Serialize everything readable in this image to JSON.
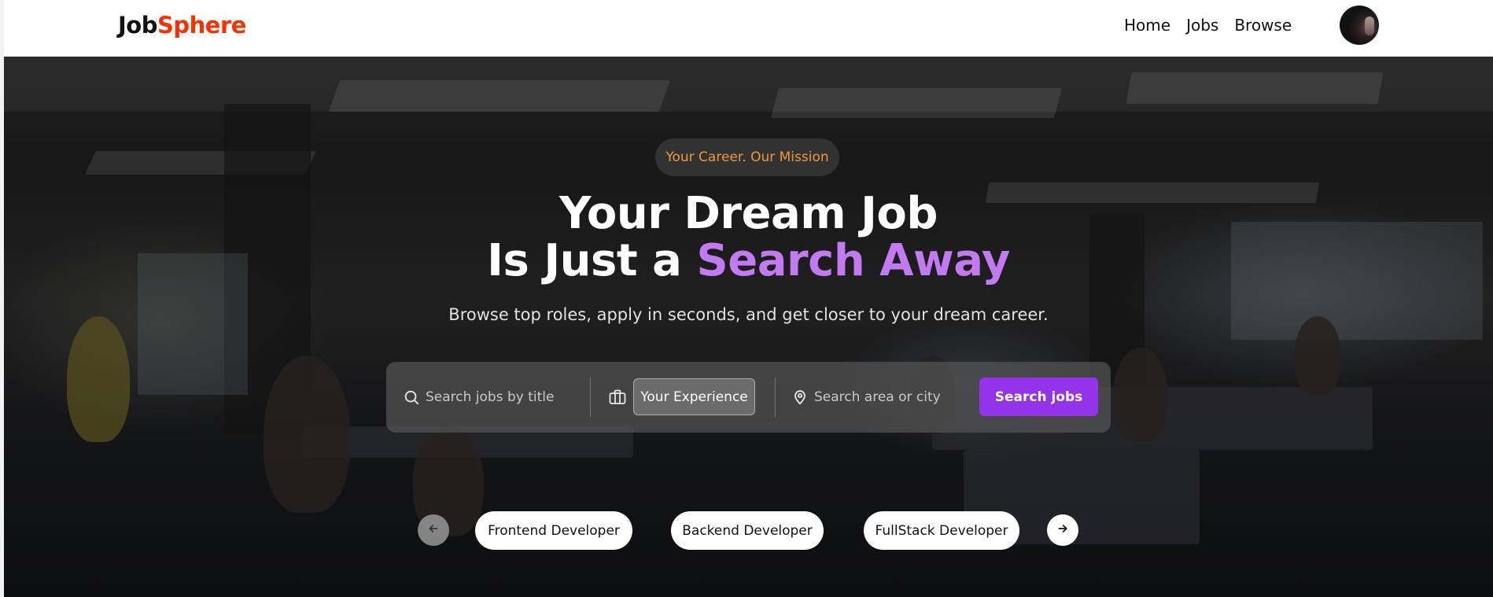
{
  "navbar": {
    "logo": {
      "part1": "Job",
      "part2": "Sphere"
    },
    "links": [
      "Home",
      "Jobs",
      "Browse"
    ],
    "avatar_icon": "user-avatar"
  },
  "hero": {
    "badge": "Your Career. Our Mission",
    "headline": {
      "line1": "Your Dream Job",
      "line2_prefix": "Is Just a ",
      "line2_accent": "Search Away"
    },
    "subtitle": "Browse top roles, apply in seconds, and get closer to your dream career."
  },
  "search": {
    "title_placeholder": "Search jobs by title",
    "experience_label": "Your Experience",
    "location_placeholder": "Search area or city",
    "button_label": "Search jobs",
    "icons": [
      "search-icon",
      "briefcase-icon",
      "map-pin-icon"
    ]
  },
  "categories": {
    "items": [
      "Frontend Developer",
      "Backend Developer",
      "FullStack Developer"
    ],
    "prev_icon": "arrow-left-icon",
    "next_icon": "arrow-right-icon"
  },
  "colors": {
    "brand_red": "#f83002",
    "accent_purple": "#9333ea",
    "headline_accent": "#c17af0",
    "badge_text": "#f0963a"
  }
}
